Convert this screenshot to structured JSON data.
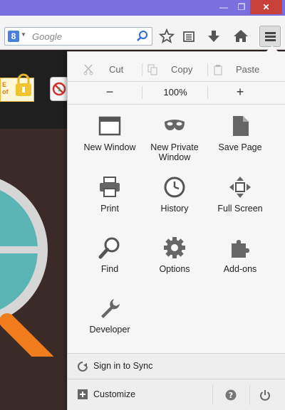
{
  "window": {
    "min_glyph": "—",
    "max_glyph": "❐",
    "close_glyph": "✕"
  },
  "search": {
    "engine_letter": "8",
    "placeholder": "Google"
  },
  "edit": {
    "cut": "Cut",
    "copy": "Copy",
    "paste": "Paste"
  },
  "zoom": {
    "minus": "−",
    "level": "100%",
    "plus": "+"
  },
  "tiles": [
    {
      "label": "New Window",
      "icon": "new-window-icon"
    },
    {
      "label": "New Private Window",
      "icon": "private-mask-icon"
    },
    {
      "label": "Save Page",
      "icon": "save-page-icon"
    },
    {
      "label": "Print",
      "icon": "printer-icon"
    },
    {
      "label": "History",
      "icon": "clock-icon"
    },
    {
      "label": "Full Screen",
      "icon": "fullscreen-icon"
    },
    {
      "label": "Find",
      "icon": "magnifier-icon"
    },
    {
      "label": "Options",
      "icon": "gear-icon"
    },
    {
      "label": "Add-ons",
      "icon": "puzzle-icon"
    },
    {
      "label": "Developer",
      "icon": "wrench-icon"
    }
  ],
  "footer": {
    "sync": "Sign in to Sync",
    "customize": "Customize"
  },
  "page_behind": {
    "tag_text": "E\nof"
  }
}
